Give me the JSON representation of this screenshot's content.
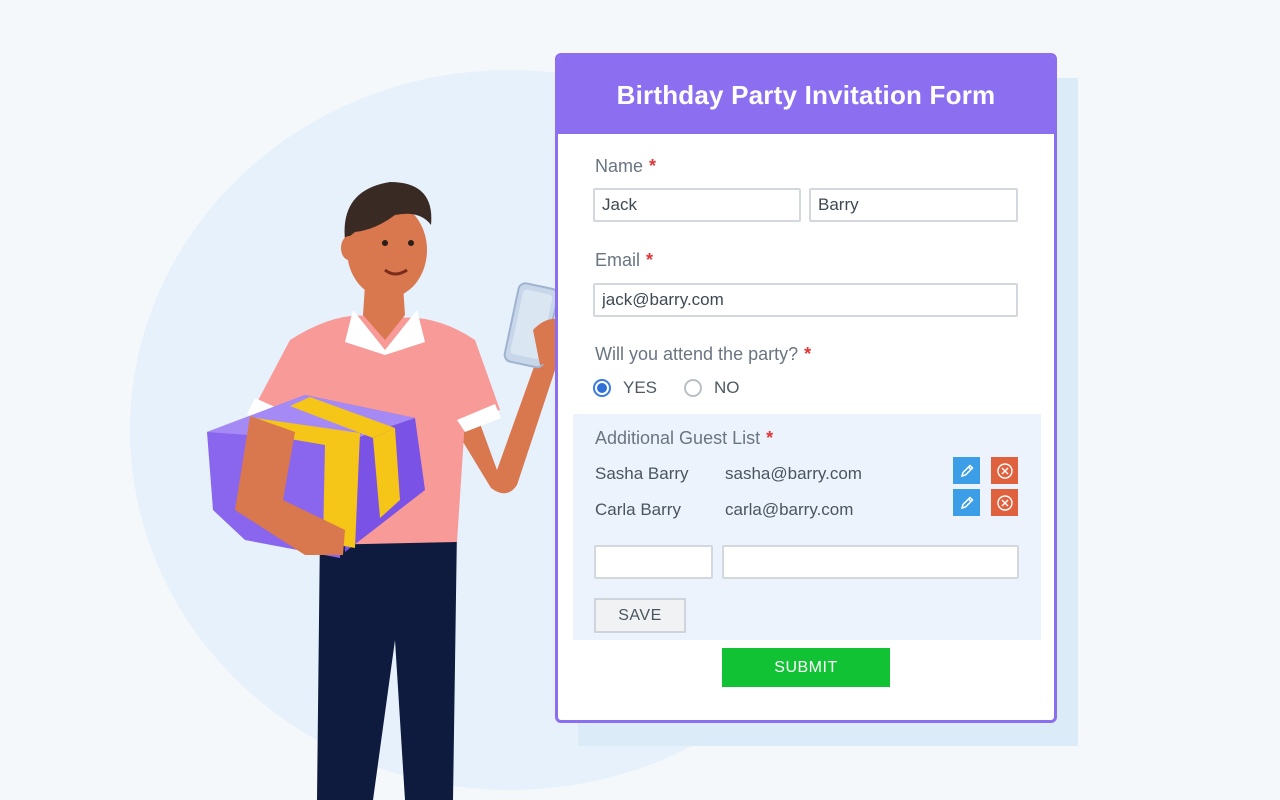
{
  "form": {
    "title": "Birthday Party Invitation Form",
    "required_mark": "*",
    "name": {
      "label": "Name",
      "first_value": "Jack",
      "last_value": "Barry"
    },
    "email": {
      "label": "Email",
      "value": "jack@barry.com"
    },
    "attend": {
      "label": "Will you attend the party?",
      "options": [
        {
          "label": "YES",
          "selected": true
        },
        {
          "label": "NO",
          "selected": false
        }
      ]
    },
    "guests": {
      "label": "Additional Guest List",
      "items": [
        {
          "name": "Sasha Barry",
          "email": "sasha@barry.com"
        },
        {
          "name": "Carla Barry",
          "email": "carla@barry.com"
        }
      ],
      "new_name_value": "",
      "new_email_value": "",
      "save_label": "SAVE"
    },
    "submit_label": "SUBMIT"
  },
  "colors": {
    "header_purple": "#8b6ff0",
    "submit_green": "#12c235",
    "edit_blue": "#3d9ee8",
    "delete_orange": "#e0613d",
    "required_red": "#e03636",
    "shirt_pink": "#f79a98",
    "gift_purple": "#8a65ee",
    "ribbon_yellow": "#f5c518",
    "pants_navy": "#0e1a3e"
  },
  "icons": {
    "edit": "pencil-icon",
    "delete": "close-circle-icon"
  }
}
